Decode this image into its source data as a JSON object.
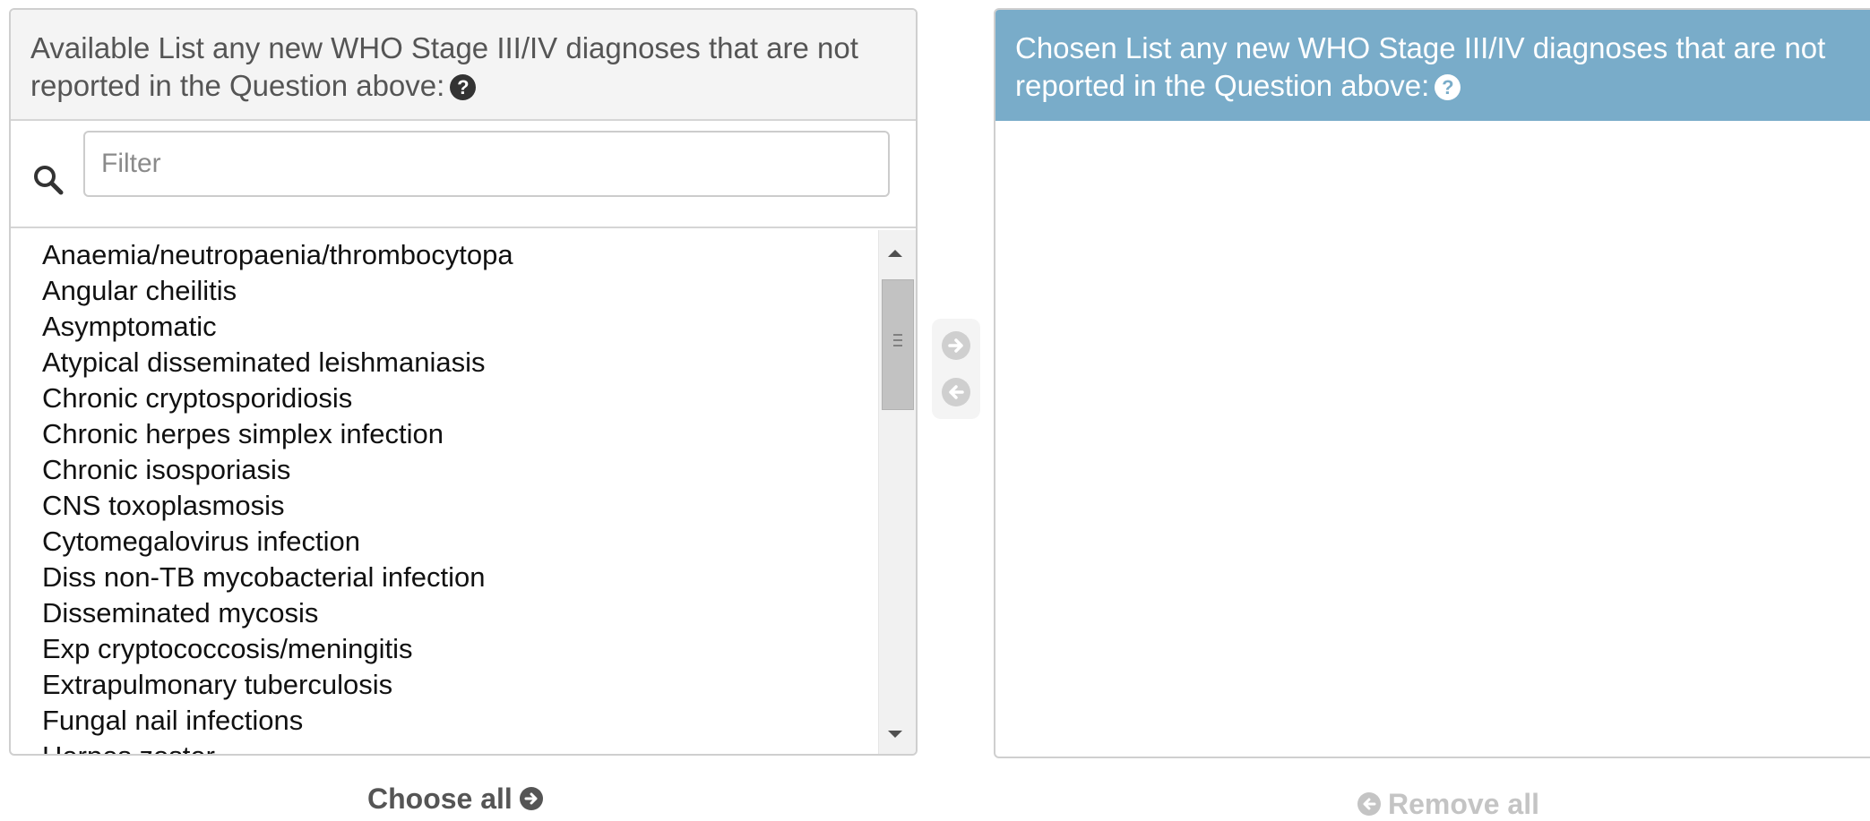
{
  "available": {
    "title": "Available List any new WHO Stage III/IV diagnoses that are not reported in the Question above:",
    "help_icon": "question-circle-icon",
    "filter_placeholder": "Filter",
    "filter_value": "",
    "options": [
      "Anaemia/neutropaenia/thrombocytopa",
      "Angular cheilitis",
      "Asymptomatic",
      "Atypical disseminated leishmaniasis",
      "Chronic cryptosporidiosis",
      "Chronic herpes simplex infection",
      "Chronic isosporiasis",
      "CNS toxoplasmosis",
      "Cytomegalovirus infection",
      "Diss non-TB mycobacterial infection",
      "Disseminated mycosis",
      "Exp cryptococcosis/meningitis",
      "Extrapulmonary tuberculosis",
      "Fungal nail infections",
      "Herpes zoster"
    ],
    "choose_all_label": "Choose all"
  },
  "chosen": {
    "title": "Chosen List any new WHO Stage III/IV diagnoses that are not reported in the Question above:",
    "help_icon": "question-circle-icon",
    "options": [],
    "remove_all_label": "Remove all"
  },
  "colors": {
    "chosen_header_bg": "#79acc9",
    "available_header_bg": "#f4f4f4",
    "disabled_text": "#c4c4c4"
  }
}
